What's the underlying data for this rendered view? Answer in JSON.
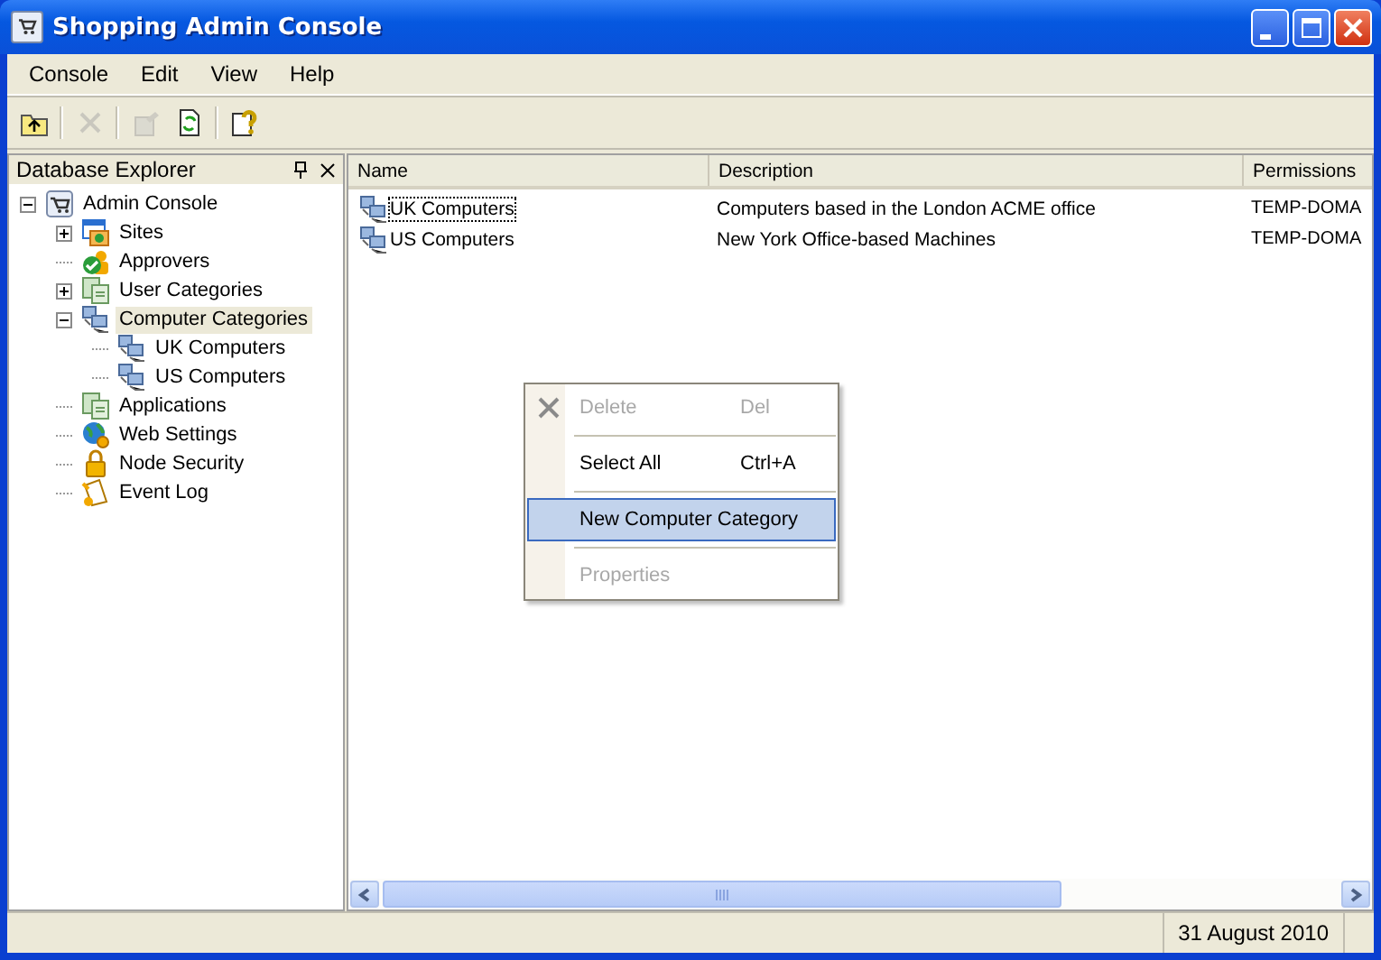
{
  "window": {
    "title": "Shopping Admin Console",
    "controls": [
      {
        "kind": "minimize"
      },
      {
        "kind": "maximize"
      },
      {
        "kind": "close"
      }
    ]
  },
  "menu": [
    "Console",
    "Edit",
    "View",
    "Help"
  ],
  "toolbar": [
    {
      "kind": "up",
      "disabled": false
    },
    {
      "kind": "separator"
    },
    {
      "kind": "delete",
      "disabled": true
    },
    {
      "kind": "separator"
    },
    {
      "kind": "properties",
      "disabled": true
    },
    {
      "kind": "refresh",
      "disabled": false
    },
    {
      "kind": "separator"
    },
    {
      "kind": "help",
      "disabled": false
    }
  ],
  "explorer": {
    "title": "Database Explorer",
    "tree": [
      {
        "label": "Admin Console",
        "kind": "cart",
        "expanded": true,
        "selected": false,
        "children": [
          {
            "label": "Sites",
            "kind": "sites",
            "expanded": false,
            "selected": false
          },
          {
            "label": "Approvers",
            "kind": "approvers",
            "selected": false
          },
          {
            "label": "User Categories",
            "kind": "pages",
            "expanded": false,
            "selected": false
          },
          {
            "label": "Computer Categories",
            "kind": "computers",
            "expanded": true,
            "selected": true,
            "children": [
              {
                "label": "UK Computers",
                "kind": "computers",
                "selected": false
              },
              {
                "label": "US Computers",
                "kind": "computers",
                "selected": false
              }
            ]
          },
          {
            "label": "Applications",
            "kind": "pages",
            "selected": false
          },
          {
            "label": "Web Settings",
            "kind": "globe",
            "selected": false
          },
          {
            "label": "Node Security",
            "kind": "lock",
            "selected": false
          },
          {
            "label": "Event Log",
            "kind": "log",
            "selected": false
          }
        ]
      }
    ]
  },
  "list": {
    "columns": [
      "Name",
      "Description",
      "Permissions"
    ],
    "rows": [
      {
        "cells": [
          "UK Computers",
          "Computers based in the London ACME office",
          "TEMP-DOMA"
        ],
        "focused": true
      },
      {
        "cells": [
          "US Computers",
          "New York Office-based Machines",
          "TEMP-DOMA"
        ],
        "focused": false
      }
    ]
  },
  "context_menu": {
    "items": [
      {
        "kind": "delete",
        "label": "Delete",
        "shortcut": "Del",
        "disabled": true,
        "selected": false
      },
      {
        "kind": "separator"
      },
      {
        "kind": "item",
        "label": "Select All",
        "shortcut": "Ctrl+A",
        "disabled": false,
        "selected": false
      },
      {
        "kind": "separator"
      },
      {
        "kind": "item",
        "label": "New Computer Category",
        "disabled": false,
        "selected": true
      },
      {
        "kind": "separator"
      },
      {
        "kind": "item",
        "label": "Properties",
        "disabled": true,
        "selected": false
      }
    ]
  },
  "status_bar": {
    "date": "31 August 2010"
  }
}
